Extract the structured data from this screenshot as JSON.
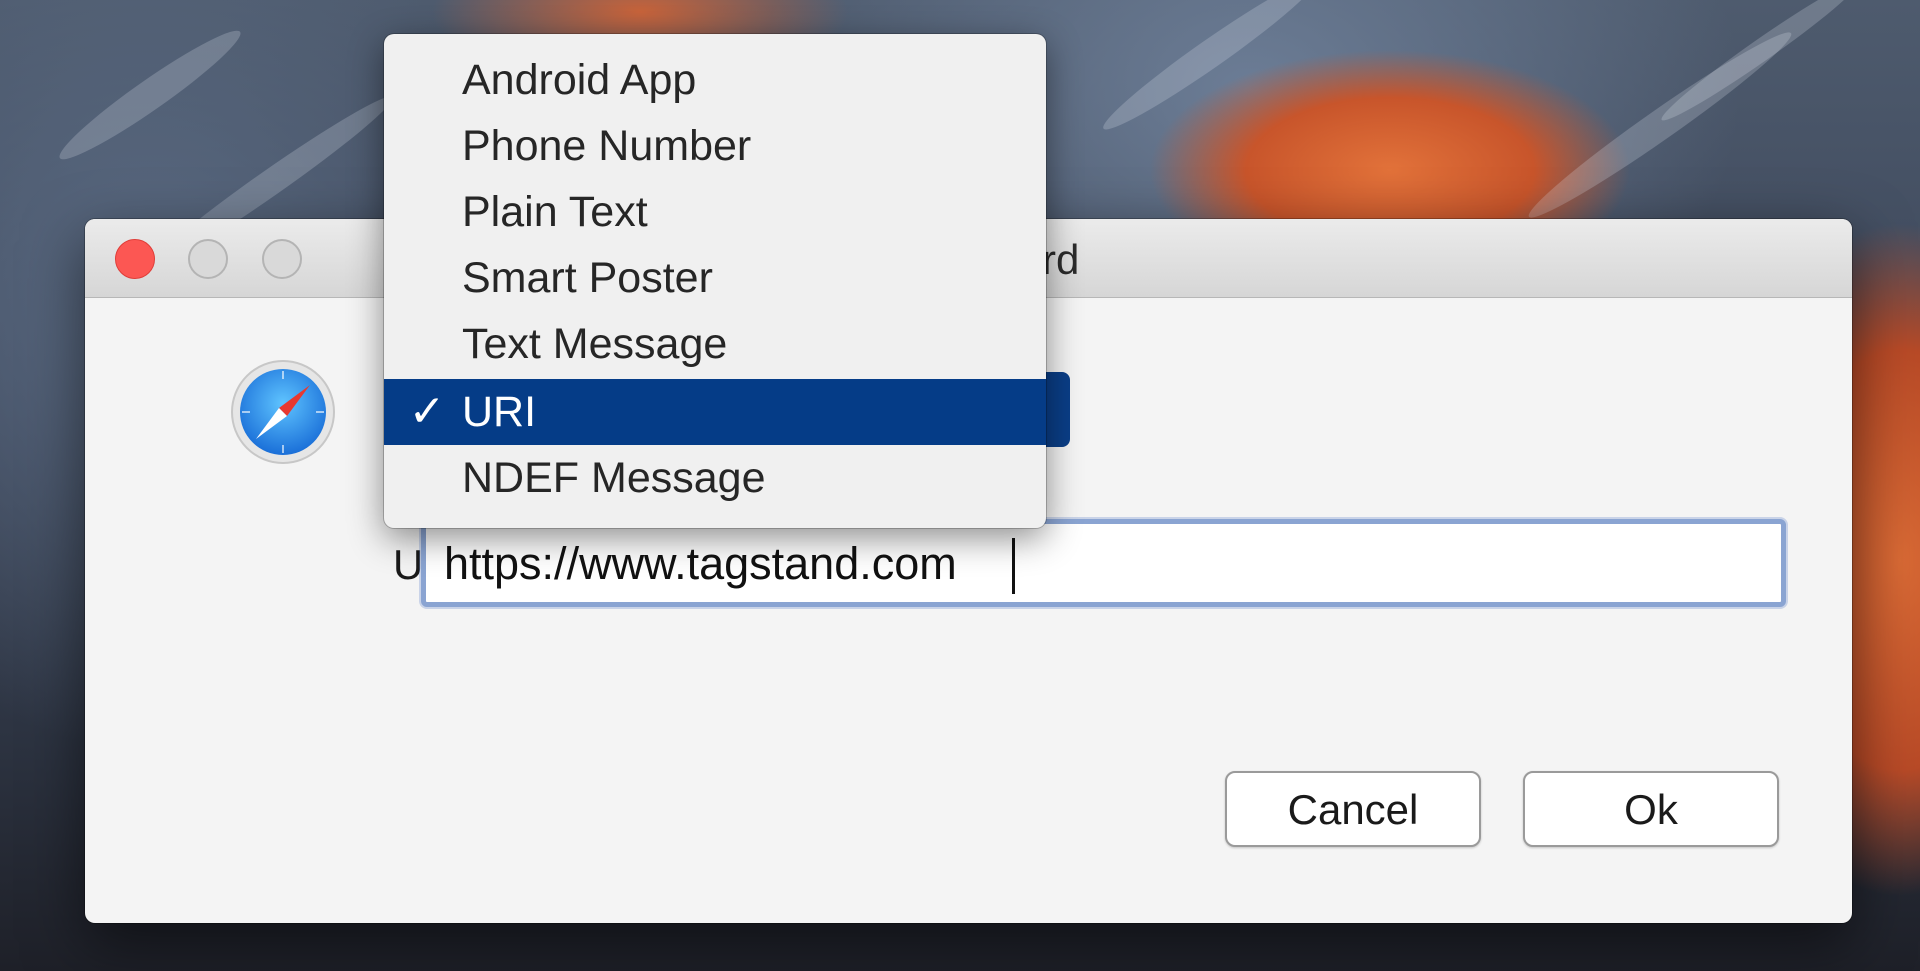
{
  "window": {
    "title": "Add Record"
  },
  "app_icon": "safari-compass-icon",
  "record_type": {
    "selected": "URI",
    "options": [
      "Android App",
      "Phone Number",
      "Plain Text",
      "Smart Poster",
      "Text Message",
      "URI",
      "NDEF Message"
    ]
  },
  "uri_field": {
    "label": "URI:",
    "value": "https://www.tagstand.com"
  },
  "buttons": {
    "cancel": "Cancel",
    "ok": "Ok"
  },
  "colors": {
    "selection": "#053c87",
    "close_button": "#fc5753",
    "field_focus": "#8aa4d2"
  }
}
